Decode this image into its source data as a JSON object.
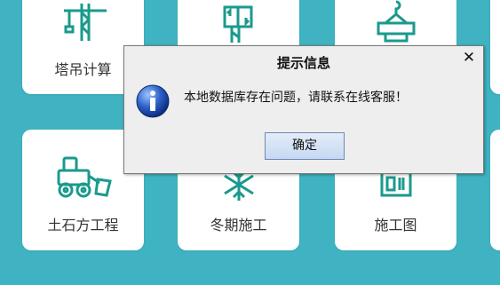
{
  "tiles": [
    {
      "label": "塔吊计算",
      "icon": "tower-crane-icon"
    },
    {
      "label": "",
      "icon": "crane-calc-icon"
    },
    {
      "label": "",
      "icon": "hoist-icon"
    },
    {
      "label": "土石方工程",
      "icon": "excavator-icon"
    },
    {
      "label": "冬期施工",
      "icon": "snowflake-icon"
    },
    {
      "label": "施工图",
      "icon": "blueprint-icon"
    }
  ],
  "dialog": {
    "title": "提示信息",
    "close_glyph": "✕",
    "icon": "info-icon",
    "message": "本地数据库存在问题，请联系在线客服！",
    "ok_label": "确定"
  },
  "colors": {
    "background": "#3fb3c2",
    "icon_teal": "#1a9a8c",
    "tile": "#ffffff"
  }
}
